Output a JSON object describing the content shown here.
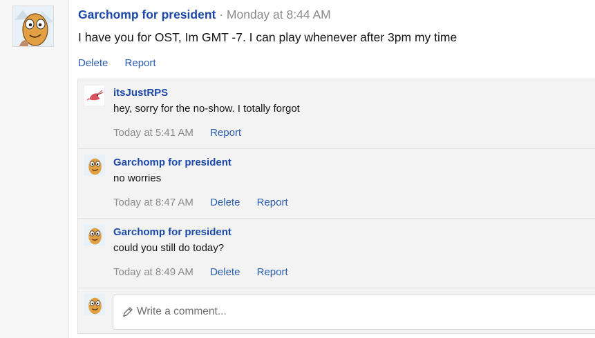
{
  "post": {
    "author": "Garchomp for president",
    "separator": "·",
    "time": "Monday at 8:44 AM",
    "body": "I have you for OST, Im GMT -7. I can play whenever after 3pm my time",
    "actions": {
      "delete": "Delete",
      "report": "Report"
    }
  },
  "comments": [
    {
      "author": "itsJustRPS",
      "text": "hey, sorry for the no-show. I totally forgot",
      "time": "Today at 5:41 AM",
      "report": "Report"
    },
    {
      "author": "Garchomp for president",
      "text": "no worries",
      "time": "Today at 8:47 AM",
      "delete": "Delete",
      "report": "Report"
    },
    {
      "author": "Garchomp for president",
      "text": "could you still do today?",
      "time": "Today at 8:49 AM",
      "delete": "Delete",
      "report": "Report"
    }
  ],
  "reply": {
    "placeholder": "Write a comment..."
  },
  "icons": {
    "edit": "pencil-icon"
  },
  "colors": {
    "link": "#2a5db0",
    "author": "#1c48a8",
    "muted": "#8a8a8a",
    "panel": "#f3f3f3"
  }
}
